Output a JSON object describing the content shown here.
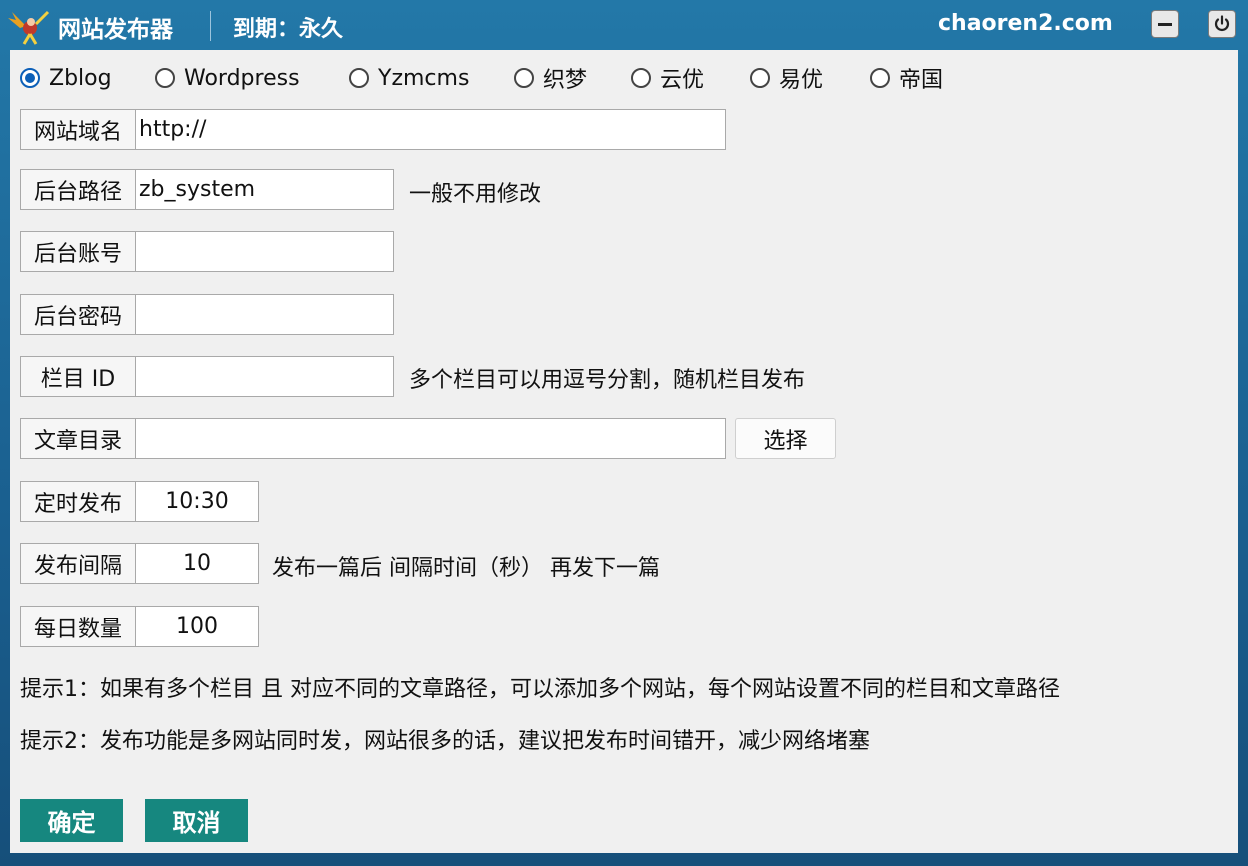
{
  "titlebar": {
    "app_title": "网站发布器",
    "expiry": "到期：永久",
    "site": "chaoren2.com",
    "icons": [
      "logo-icon",
      "minimize-icon",
      "power-icon"
    ]
  },
  "cms": {
    "selected": "Zblog",
    "options": [
      "Zblog",
      "Wordpress",
      "Yzmcms",
      "织梦",
      "云优",
      "易优",
      "帝国"
    ]
  },
  "fields": {
    "domain": {
      "label": "网站域名",
      "value": "http://"
    },
    "admin_path": {
      "label": "后台路径",
      "value": "zb_system",
      "hint": "一般不用修改"
    },
    "account": {
      "label": "后台账号",
      "value": ""
    },
    "password": {
      "label": "后台密码",
      "value": ""
    },
    "category": {
      "label": "栏目 ID",
      "value": "",
      "hint": "多个栏目可以用逗号分割，随机栏目发布"
    },
    "article_dir": {
      "label": "文章目录",
      "value": "",
      "button": "选择"
    },
    "schedule": {
      "label": "定时发布",
      "value": "10:30"
    },
    "interval": {
      "label": "发布间隔",
      "value": "10",
      "hint": "发布一篇后 间隔时间（秒） 再发下一篇"
    },
    "daily_count": {
      "label": "每日数量",
      "value": "100"
    }
  },
  "tips": [
    "提示1：如果有多个栏目 且 对应不同的文章路径，可以添加多个网站，每个网站设置不同的栏目和文章路径",
    "提示2：发布功能是多网站同时发，网站很多的话，建议把发布时间错开，减少网络堵塞"
  ],
  "actions": {
    "ok": "确定",
    "cancel": "取消"
  },
  "colors": {
    "titlebar": "#1f6f9f",
    "radio_selected": "#0b5fb8",
    "action_button": "#16877f"
  }
}
